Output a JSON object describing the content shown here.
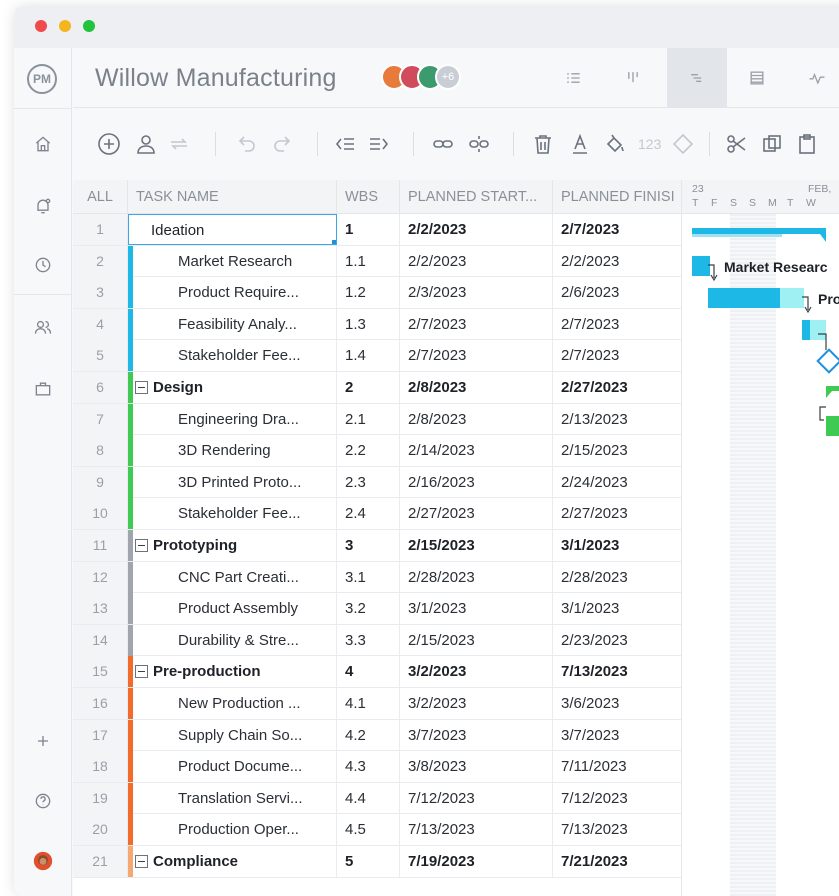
{
  "window": {
    "controls": [
      "close",
      "minimize",
      "maximize"
    ]
  },
  "app": {
    "logo_text": "PM",
    "project_title": "Willow Manufacturing",
    "more_members": "+6"
  },
  "toolbar": {
    "numbering_label": "123"
  },
  "grid": {
    "headers": {
      "all": "ALL",
      "task_name": "TASK NAME",
      "wbs": "WBS",
      "planned_start": "PLANNED START...",
      "planned_finish": "PLANNED FINISI"
    },
    "rows": [
      {
        "num": "1",
        "name": "Ideation",
        "wbs": "1",
        "start": "2/2/2023",
        "end": "2/7/2023",
        "group": true
      },
      {
        "num": "2",
        "name": "Market Research",
        "wbs": "1.1",
        "start": "2/2/2023",
        "end": "2/2/2023"
      },
      {
        "num": "3",
        "name": "Product Require...",
        "wbs": "1.2",
        "start": "2/3/2023",
        "end": "2/6/2023"
      },
      {
        "num": "4",
        "name": "Feasibility Analy...",
        "wbs": "1.3",
        "start": "2/7/2023",
        "end": "2/7/2023"
      },
      {
        "num": "5",
        "name": "Stakeholder Fee...",
        "wbs": "1.4",
        "start": "2/7/2023",
        "end": "2/7/2023"
      },
      {
        "num": "6",
        "name": "Design",
        "wbs": "2",
        "start": "2/8/2023",
        "end": "2/27/2023",
        "group": true
      },
      {
        "num": "7",
        "name": "Engineering Dra...",
        "wbs": "2.1",
        "start": "2/8/2023",
        "end": "2/13/2023"
      },
      {
        "num": "8",
        "name": "3D Rendering",
        "wbs": "2.2",
        "start": "2/14/2023",
        "end": "2/15/2023"
      },
      {
        "num": "9",
        "name": "3D Printed Proto...",
        "wbs": "2.3",
        "start": "2/16/2023",
        "end": "2/24/2023"
      },
      {
        "num": "10",
        "name": "Stakeholder Fee...",
        "wbs": "2.4",
        "start": "2/27/2023",
        "end": "2/27/2023"
      },
      {
        "num": "11",
        "name": "Prototyping",
        "wbs": "3",
        "start": "2/15/2023",
        "end": "3/1/2023",
        "group": true
      },
      {
        "num": "12",
        "name": "CNC Part Creati...",
        "wbs": "3.1",
        "start": "2/28/2023",
        "end": "2/28/2023"
      },
      {
        "num": "13",
        "name": "Product Assembly",
        "wbs": "3.2",
        "start": "3/1/2023",
        "end": "3/1/2023"
      },
      {
        "num": "14",
        "name": "Durability & Stre...",
        "wbs": "3.3",
        "start": "2/15/2023",
        "end": "2/23/2023"
      },
      {
        "num": "15",
        "name": "Pre-production",
        "wbs": "4",
        "start": "3/2/2023",
        "end": "7/13/2023",
        "group": true
      },
      {
        "num": "16",
        "name": "New Production ...",
        "wbs": "4.1",
        "start": "3/2/2023",
        "end": "3/6/2023"
      },
      {
        "num": "17",
        "name": "Supply Chain So...",
        "wbs": "4.2",
        "start": "3/7/2023",
        "end": "3/7/2023"
      },
      {
        "num": "18",
        "name": "Product Docume...",
        "wbs": "4.3",
        "start": "3/8/2023",
        "end": "7/11/2023"
      },
      {
        "num": "19",
        "name": "Translation Servi...",
        "wbs": "4.4",
        "start": "7/12/2023",
        "end": "7/12/2023"
      },
      {
        "num": "20",
        "name": "Production Oper...",
        "wbs": "4.5",
        "start": "7/13/2023",
        "end": "7/13/2023"
      },
      {
        "num": "21",
        "name": "Compliance",
        "wbs": "5",
        "start": "7/19/2023",
        "end": "7/21/2023",
        "group": true
      }
    ]
  },
  "gantt": {
    "date_label_left": "23",
    "date_label_right": "FEB,",
    "day_letters": [
      "T",
      "F",
      "S",
      "S",
      "M",
      "T",
      "W"
    ],
    "labels": {
      "market_research": "Market Researc",
      "product_req": "Pro"
    }
  },
  "colors": {
    "ideation": "#1eb8e6",
    "design": "#3fca53",
    "prototyping": "#a0a5ad",
    "preproduction": "#f26b2a",
    "compliance": "#f4a872",
    "selection": "#3aa6e8"
  }
}
